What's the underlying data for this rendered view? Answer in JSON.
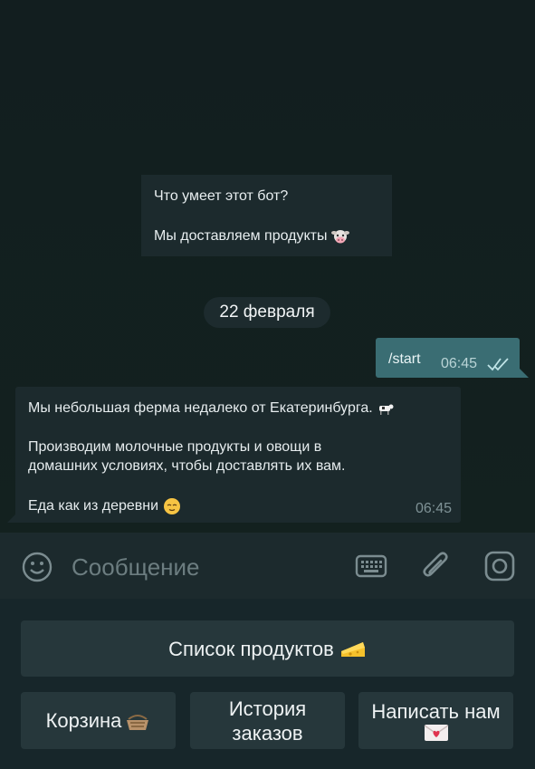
{
  "bot_info": {
    "title": "Что умеет этот бот?",
    "description": "Мы доставляем продукты",
    "description_emoji": "cow-face-icon"
  },
  "date_separator": "22 февраля",
  "outgoing_message": {
    "text": "/start",
    "time": "06:45",
    "status_icon": "double-check-icon"
  },
  "incoming_message": {
    "line1": "Мы небольшая ферма недалеко от Екатеринбурга.",
    "line1_emoji": "cow-icon",
    "line2": "Производим молочные продукты и овощи в",
    "line3": "домашних условиях, чтобы доставлять их вам.",
    "line4": "Еда как из деревни",
    "line4_emoji": "relieved-face-icon",
    "time": "06:45"
  },
  "input": {
    "placeholder": "Сообщение"
  },
  "keyboard": {
    "products_label": "Список продуктов",
    "products_emoji": "cheese-icon",
    "cart_label": "Корзина",
    "cart_emoji": "basket-icon",
    "history_line1": "История",
    "history_line2": "заказов",
    "contact_label": "Написать нам",
    "contact_emoji": "love-letter-icon"
  },
  "colors": {
    "chat_background": "#13201f",
    "bubble_incoming": "#1c2a2d",
    "bubble_outgoing": "#3a6d73",
    "keyboard_button": "#26373b"
  }
}
